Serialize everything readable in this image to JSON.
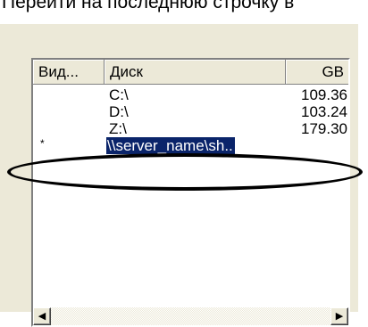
{
  "caption": "Перейти на последнюю строчку в",
  "columns": [
    {
      "label": "Вид..."
    },
    {
      "label": "Диск"
    },
    {
      "label": "GB"
    }
  ],
  "rows": [
    {
      "type": "",
      "disk": "C:\\",
      "gb": "109.36"
    },
    {
      "type": "",
      "disk": "D:\\",
      "gb": "103.24"
    },
    {
      "type": "",
      "disk": "Z:\\",
      "gb": "179.30"
    },
    {
      "type": "*",
      "disk": "\\\\server_name\\sh..",
      "gb": ""
    }
  ],
  "scrollbar": {
    "left_arrow": "◀",
    "right_arrow": "▶"
  },
  "colors": {
    "selection": "#0a246a",
    "window": "#ece9d8"
  }
}
